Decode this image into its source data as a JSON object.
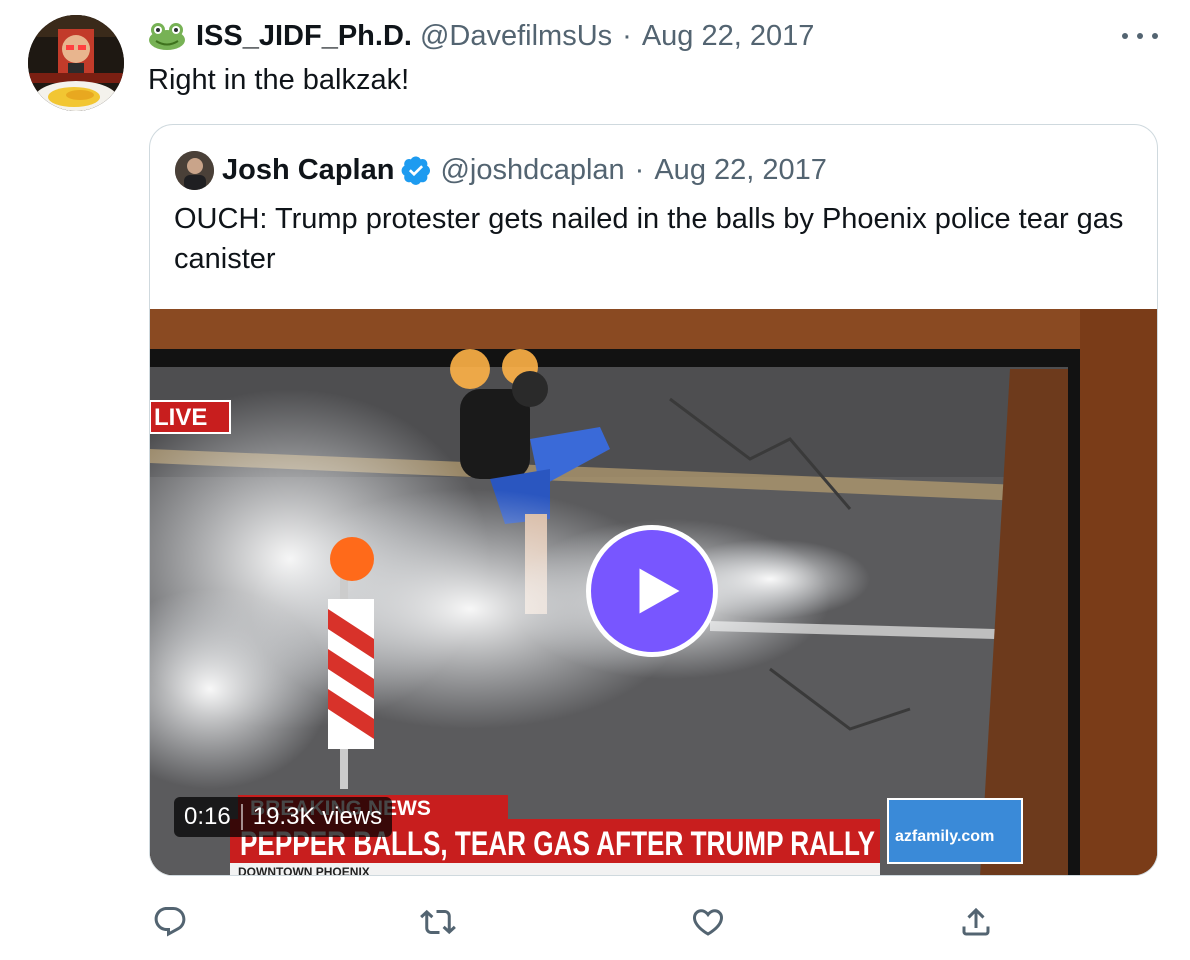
{
  "tweet": {
    "display_name": "ISS_JIDF_Ph.D.",
    "handle": "@DavefilmsUs",
    "separator": "·",
    "date": "Aug 22, 2017",
    "text": "Right in the balkzak!",
    "name_emoji_icon": "frog-face-icon"
  },
  "quote": {
    "display_name": "Josh Caplan",
    "verified": true,
    "handle": "@joshdcaplan",
    "separator": "·",
    "date": "Aug 22, 2017",
    "text": "OUCH: Trump protester gets nailed in the balls by Phoenix police tear gas canister",
    "video": {
      "duration": "0:16",
      "views": "19.3K views",
      "overlay": {
        "live_label": "LIVE",
        "breaking_label": "BREAKING NEWS",
        "headline": "PEPPER BALLS, TEAR GAS AFTER TRUMP RALLY",
        "location": "DOWNTOWN PHOENIX",
        "station": "azfamily.com"
      }
    }
  },
  "actions": [
    {
      "name": "reply",
      "icon": "reply-icon"
    },
    {
      "name": "retweet",
      "icon": "retweet-icon"
    },
    {
      "name": "like",
      "icon": "heart-icon"
    },
    {
      "name": "share",
      "icon": "share-icon"
    }
  ],
  "colors": {
    "text_primary": "#0f1419",
    "text_secondary": "#536471",
    "border": "#cfd9de",
    "verified_blue": "#1d9bf0",
    "play_purple": "#7856ff"
  }
}
